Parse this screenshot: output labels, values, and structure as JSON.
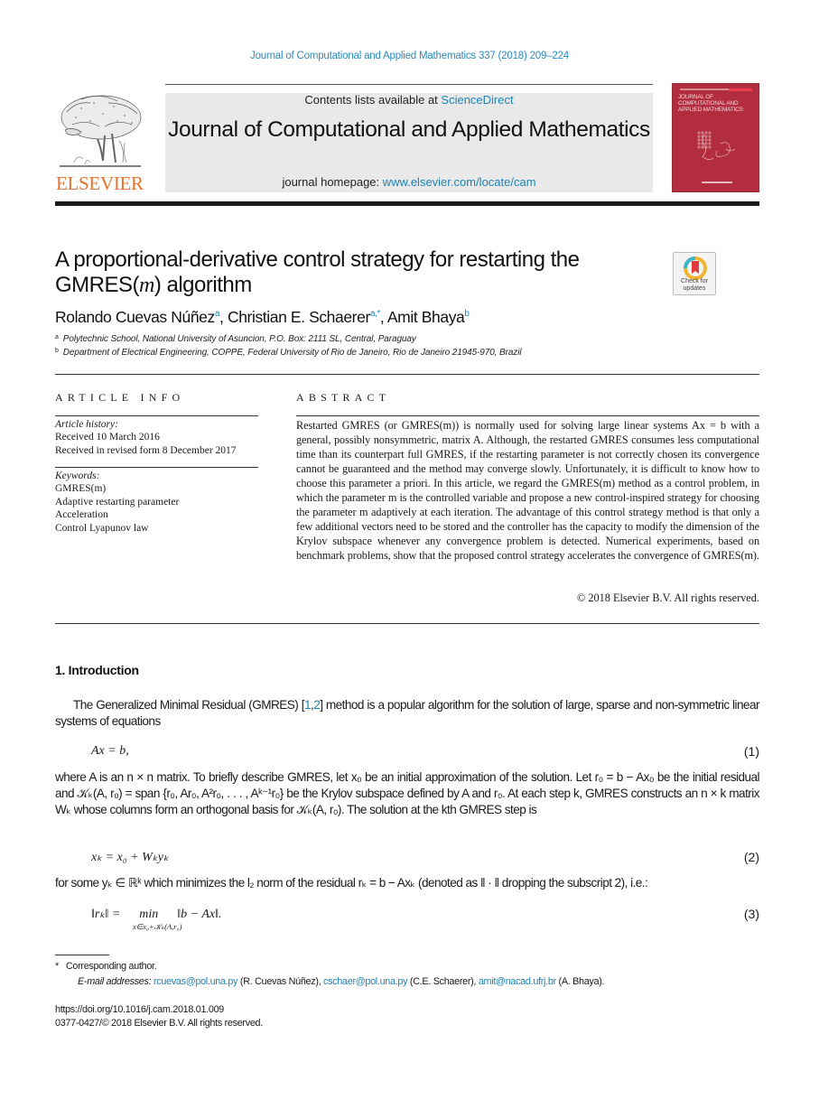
{
  "running_header": "Journal of Computational and Applied Mathematics 337 (2018) 209–224",
  "masthead": {
    "contents_prefix": "Contents lists available at ",
    "contents_link": "ScienceDirect",
    "journal_title": "Journal of Computational and Applied Mathematics",
    "homepage_prefix": "journal homepage: ",
    "homepage_link": "www.elsevier.com/locate/cam",
    "publisher_logo_word": "ELSEVIER",
    "cover_title": "JOURNAL OF COMPUTATIONAL AND APPLIED MATHEMATICS"
  },
  "colors": {
    "link": "#1f83b4",
    "elsevier_orange": "#e8702a",
    "cover_red": "#b22e3f",
    "masthead_gray": "#e9e9e9"
  },
  "article": {
    "title_part1": "A proportional-derivative control strategy for restarting the GMRES(",
    "title_math": "m",
    "title_part2": ") algorithm",
    "check_updates_label": "Check for updates",
    "authors": [
      {
        "name": "Rolando Cuevas Núñez",
        "sup": "a"
      },
      {
        "name": "Christian E. Schaerer",
        "sup": "a,*"
      },
      {
        "name": "Amit Bhaya",
        "sup": "b"
      }
    ],
    "affiliations": [
      {
        "mark": "a",
        "text": "Polytechnic School, National University of Asuncion, P.O. Box: 2111 SL, Central, Paraguay"
      },
      {
        "mark": "b",
        "text": "Department of Electrical Engineering, COPPE, Federal University of Rio de Janeiro, Rio de Janeiro 21945-970, Brazil"
      }
    ]
  },
  "article_info": {
    "heading": "ARTICLE INFO",
    "history_label": "Article history:",
    "history": [
      "Received 10 March 2016",
      "Received in revised form 8 December 2017"
    ],
    "keywords_label": "Keywords:",
    "keywords": [
      "GMRES(m)",
      "Adaptive restarting parameter",
      "Acceleration",
      "Control Lyapunov law"
    ]
  },
  "abstract": {
    "heading": "ABSTRACT",
    "text": "Restarted GMRES (or GMRES(m)) is normally used for solving large linear systems Ax = b with a general, possibly nonsymmetric, matrix A. Although, the restarted GMRES consumes less computational time than its counterpart full GMRES, if the restarting parameter is not correctly chosen its convergence cannot be guaranteed and the method may converge slowly. Unfortunately, it is difficult to know how to choose this parameter a priori. In this article, we regard the GMRES(m) method as a control problem, in which the parameter m is the controlled variable and propose a new control-inspired strategy for choosing the parameter m adaptively at each iteration. The advantage of this control strategy method is that only a few additional vectors need to be stored and the controller has the capacity to modify the dimension of the Krylov subspace whenever any convergence problem is detected. Numerical experiments, based on benchmark problems, show that the proposed control strategy accelerates the convergence of GMRES(m).",
    "copyright": "© 2018 Elsevier B.V. All rights reserved."
  },
  "introduction": {
    "heading": "1.  Introduction",
    "para1_a": "The Generalized Minimal Residual (GMRES) [",
    "para1_ref1": "1",
    "para1_ref2": "2",
    "para1_b": "] method is a popular algorithm for the solution of large, sparse and non-symmetric linear systems of equations",
    "eq1": "Ax = b,",
    "eq1_num": "(1)",
    "para2": "where A is an n × n matrix. To briefly describe GMRES, let x₀ be an initial approximation of the solution. Let r₀ = b − Ax₀ be the initial residual and 𝒦ₖ(A, r₀) = span {r₀, Ar₀, A²r₀, . . . , Aᵏ⁻¹r₀} be the Krylov subspace defined by A and r₀. At each step k, GMRES constructs an n × k matrix Wₖ whose columns form an orthogonal basis for 𝒦ₖ(A, r₀). The solution at the kth GMRES step is",
    "eq2": "xₖ = x₀ + Wₖyₖ",
    "eq2_num": "(2)",
    "para3": "for some yₖ ∈ ℝᵏ which minimizes the l₂ norm of the residual rₖ = b − Axₖ (denoted as ‖ · ‖ dropping the subscript 2), i.e.:",
    "eq3": "‖rₖ‖ =      min      ‖b − Ax‖.",
    "eq3_sub": "x∈x₀+𝒦ₖ(A,r₀)",
    "eq3_num": "(3)"
  },
  "footnotes": {
    "star_mark": "*",
    "corresponding": "Corresponding author.",
    "emails_label": "E-mail addresses: ",
    "emails": [
      {
        "address": "rcuevas@pol.una.py",
        "owner": " (R. Cuevas Núñez), "
      },
      {
        "address": "cschaer@pol.una.py",
        "owner": " (C.E. Schaerer), "
      },
      {
        "address": "amit@nacad.ufrj.br",
        "owner": " (A. Bhaya)."
      }
    ],
    "doi": "https://doi.org/10.1016/j.cam.2018.01.009",
    "issn": "0377-0427/© 2018 Elsevier B.V. All rights reserved."
  }
}
